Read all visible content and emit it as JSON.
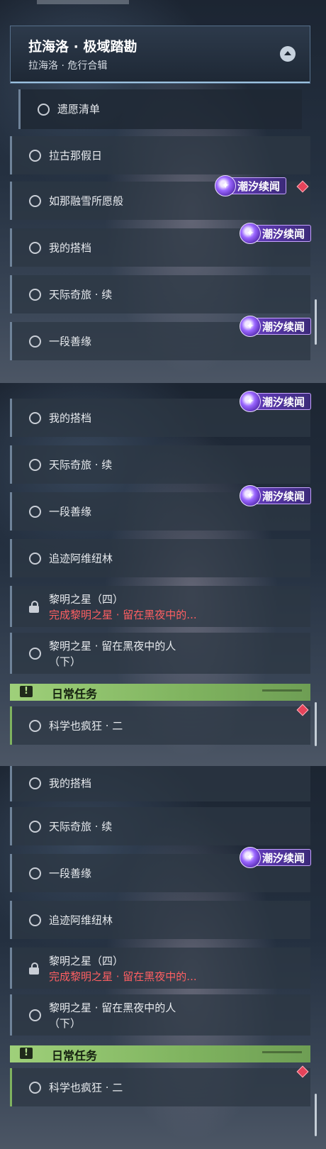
{
  "panel1": {
    "header": {
      "title": "拉海洛 · 极域踏勘",
      "subtitle": "拉海洛 · 危行合辑"
    },
    "sub_item": "遗愿清单",
    "quests": [
      "拉古那假日",
      "如那融雪所愿般",
      "我的搭档",
      "天际奇旅 · 续",
      "一段善缘"
    ]
  },
  "panel2": {
    "quests": [
      "我的搭档",
      "天际奇旅 · 续",
      "一段善缘",
      "追迹阿维纽林"
    ],
    "locked": {
      "title": "黎明之星（四）",
      "requirement": "完成黎明之星 · 留在黑夜中的..."
    },
    "two_line": {
      "line1": "黎明之星 · 留在黑夜中的人",
      "line2": "（下）"
    },
    "daily_title": "日常任务",
    "daily_quest": "科学也疯狂 · 二"
  },
  "panel3": {
    "quests": [
      "我的搭档",
      "天际奇旅 · 续",
      "一段善缘",
      "追迹阿维纽林"
    ],
    "locked": {
      "title": "黎明之星（四）",
      "requirement": "完成黎明之星 · 留在黑夜中的..."
    },
    "two_line": {
      "line1": "黎明之星 · 留在黑夜中的人",
      "line2": "（下）"
    },
    "daily_title": "日常任务",
    "daily_quest": "科学也疯狂 · 二"
  },
  "tag_label": "潮汐续闻",
  "daily_icon": "!",
  "icons": {
    "quest": "circle-icon",
    "lock": "lock-icon",
    "tag": "tide-sparkle-icon",
    "alert": "red-diamond-icon",
    "collapse": "collapse-arrow-icon"
  },
  "colors": {
    "tag": "#6a3fc8",
    "alert": "#e5435a",
    "daily": "#9fd07a",
    "requirement": "#ff5f62"
  }
}
